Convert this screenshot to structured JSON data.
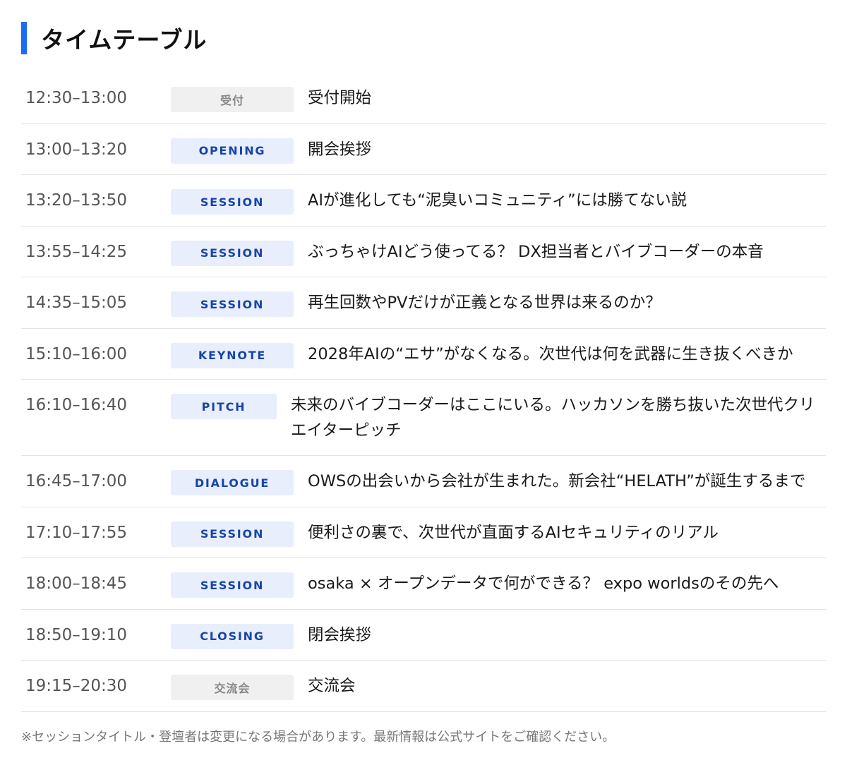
{
  "heading": {
    "title": "タイムテーブル",
    "accent_color": "#1a6cf5"
  },
  "sessions": [
    {
      "time": "12:30–13:00",
      "tag": "受付",
      "title": "受付開始"
    },
    {
      "time": "13:00–13:20",
      "tag": "OPENING",
      "title": "開会挨拶"
    },
    {
      "time": "13:20–13:50",
      "tag": "SESSION",
      "title": "AIが進化しても“泥臭いコミュニティ”には勝てない説"
    },
    {
      "time": "13:55–14:25",
      "tag": "SESSION",
      "title": "ぶっちゃけAIどう使ってる？ DX担当者とバイブコーダーの本音"
    },
    {
      "time": "14:35–15:05",
      "tag": "SESSION",
      "title": "再生回数やPVだけが正義となる世界は来るのか？"
    },
    {
      "time": "15:10–16:00",
      "tag": "KEYNOTE",
      "title": "2028年AIの“エサ”がなくなる。次世代は何を武器に生き抜くべきか"
    },
    {
      "time": "16:10–16:40",
      "tag": "PITCH",
      "title": "未来のバイブコーダーはここにいる。ハッカソンを勝ち抜いた次世代クリエイターピッチ"
    },
    {
      "time": "16:45–17:00",
      "tag": "DIALOGUE",
      "title": "OWSの出会いから会社が生まれた。新会社“HELATH”が誕生するまで"
    },
    {
      "time": "17:10–17:55",
      "tag": "SESSION",
      "title": "便利さの裏で、次世代が直面するAIセキュリティのリアル"
    },
    {
      "time": "18:00–18:45",
      "tag": "SESSION",
      "title": "osaka × オープンデータで何ができる？ expo worldsのその先へ"
    },
    {
      "time": "18:50–19:10",
      "tag": "CLOSING",
      "title": "閉会挨拶"
    },
    {
      "time": "19:15–20:30",
      "tag": "交流会",
      "title": "交流会"
    }
  ],
  "footnote": "※セッションタイトル・登壇者は変更になる場合があります。最新情報は公式サイトをご確認ください。",
  "colors": {
    "badge_blue_bg": "#e8eefc",
    "badge_blue_text": "#1844a8",
    "badge_gray_bg": "#f0f0f1",
    "badge_gray_text": "#888888"
  }
}
